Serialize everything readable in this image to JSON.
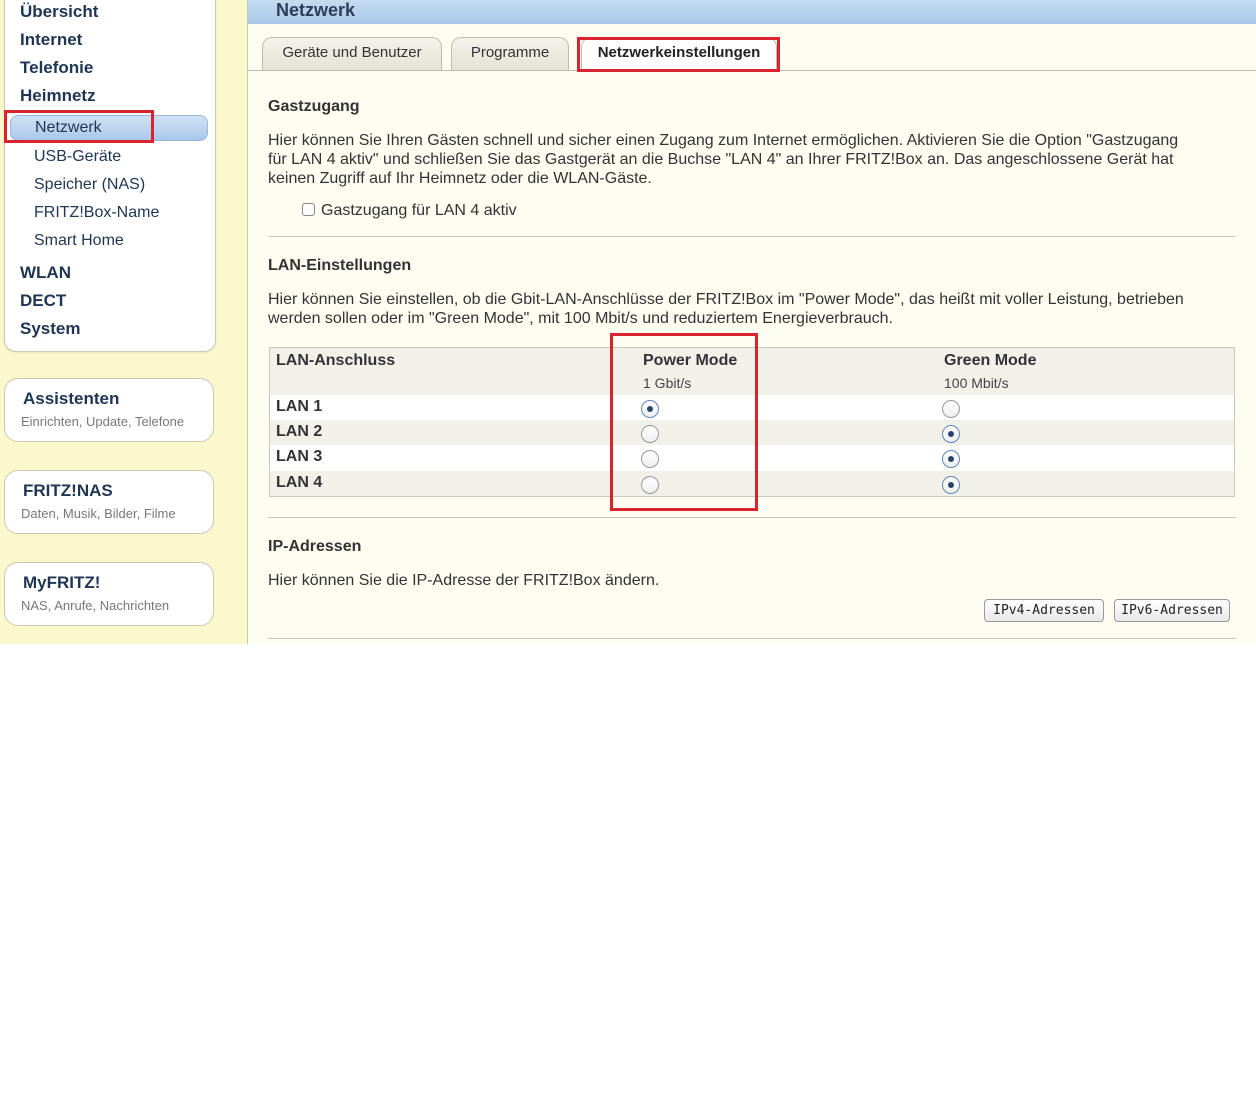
{
  "sidebar": {
    "items_top": [
      "Übersicht",
      "Internet",
      "Telefonie",
      "Heimnetz"
    ],
    "heimnetz_sub": [
      "Netzwerk",
      "USB-Geräte",
      "Speicher (NAS)",
      "FRITZ!Box-Name",
      "Smart Home"
    ],
    "items_bottom": [
      "WLAN",
      "DECT",
      "System"
    ],
    "boxes": [
      {
        "title": "Assistenten",
        "subtitle": "Einrichten, Update, Telefone"
      },
      {
        "title": "FRITZ!NAS",
        "subtitle": "Daten, Musik, Bilder, Filme"
      },
      {
        "title": "MyFRITZ!",
        "subtitle": "NAS, Anrufe, Nachrichten"
      }
    ]
  },
  "main": {
    "title": "Netzwerk",
    "tabs": [
      "Geräte und Benutzer",
      "Programme",
      "Netzwerkeinstellungen"
    ],
    "active_tab": "Netzwerkeinstellungen",
    "guest": {
      "title": "Gastzugang",
      "line1": "Hier können Sie Ihren Gästen schnell und sicher einen Zugang zum Internet ermöglichen. Aktivieren Sie die Option \"Gastzugang",
      "line2": "für LAN 4 aktiv\" und schließen Sie das Gastgerät an die Buchse \"LAN 4\" an Ihrer FRITZ!Box an. Das angeschlossene Gerät hat",
      "line3": "keinen Zugriff auf Ihr Heimnetz oder die WLAN-Gäste.",
      "checkbox_label": "Gastzugang für LAN 4 aktiv",
      "checked": false
    },
    "lan": {
      "title": "LAN-Einstellungen",
      "line1": "Hier können Sie einstellen, ob die Gbit-LAN-Anschlüsse der FRITZ!Box im \"Power Mode\", das heißt mit voller Leistung, betrieben",
      "line2": "werden sollen oder im \"Green Mode\", mit 100 Mbit/s und reduziertem Energieverbrauch.",
      "col_port": "LAN-Anschluss",
      "col_power": "Power Mode",
      "col_power_sub": "1 Gbit/s",
      "col_green": "Green Mode",
      "col_green_sub": "100 Mbit/s",
      "rows": [
        {
          "name": "LAN 1",
          "mode": "power"
        },
        {
          "name": "LAN 2",
          "mode": "green"
        },
        {
          "name": "LAN 3",
          "mode": "green"
        },
        {
          "name": "LAN 4",
          "mode": "green"
        }
      ]
    },
    "ip": {
      "title": "IP-Adressen",
      "text": "Hier können Sie die IP-Adresse der FRITZ!Box ändern.",
      "btn_ipv4": "IPv4-Adressen",
      "btn_ipv6": "IPv6-Adressen"
    }
  },
  "colors": {
    "highlight": "#d7242e",
    "background": "#fbf8cc",
    "header": "#b6d2ec",
    "nav_text": "#1f3554"
  }
}
